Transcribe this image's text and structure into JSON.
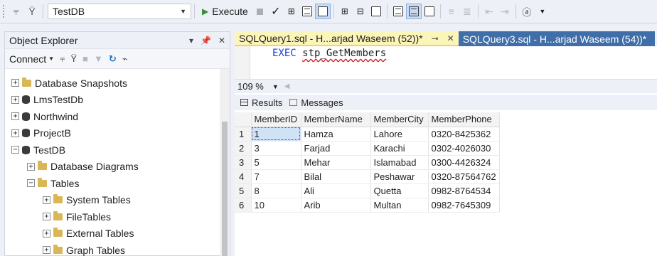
{
  "toolbar": {
    "database_selector": "TestDB",
    "execute_label": "Execute"
  },
  "object_explorer": {
    "title": "Object Explorer",
    "header_controls": [
      "▾",
      "ᵽ",
      "✕"
    ],
    "connect_label": "Connect",
    "tree": [
      {
        "label": "Database Snapshots",
        "icon": "folder",
        "expander": "+",
        "indent": 1
      },
      {
        "label": "LmsTestDb",
        "icon": "database",
        "expander": "+",
        "indent": 1
      },
      {
        "label": "Northwind",
        "icon": "database",
        "expander": "+",
        "indent": 1
      },
      {
        "label": "ProjectB",
        "icon": "database",
        "expander": "+",
        "indent": 1
      },
      {
        "label": "TestDB",
        "icon": "database",
        "expander": "−",
        "indent": 1
      },
      {
        "label": "Database Diagrams",
        "icon": "folder",
        "expander": "+",
        "indent": 2
      },
      {
        "label": "Tables",
        "icon": "folder",
        "expander": "−",
        "indent": 2
      },
      {
        "label": "System Tables",
        "icon": "folder",
        "expander": "+",
        "indent": 3
      },
      {
        "label": "FileTables",
        "icon": "folder",
        "expander": "+",
        "indent": 3
      },
      {
        "label": "External Tables",
        "icon": "folder",
        "expander": "+",
        "indent": 3
      },
      {
        "label": "Graph Tables",
        "icon": "folder",
        "expander": "+",
        "indent": 3
      }
    ]
  },
  "editor": {
    "tabs": [
      {
        "label": "SQLQuery1.sql - H...arjad Waseem (52))*",
        "active": true
      },
      {
        "label": "SQLQuery3.sql - H...arjad Waseem (54))*",
        "active": false
      }
    ],
    "code": {
      "keyword": "EXEC",
      "procedure": "stp_GetMembers"
    },
    "zoom": "109 %"
  },
  "results": {
    "tabs": [
      "Results",
      "Messages"
    ],
    "columns": [
      "MemberID",
      "MemberName",
      "MemberCity",
      "MemberPhone"
    ],
    "rows": [
      [
        "1",
        "1",
        "Hamza",
        "Lahore",
        "0320-8425362"
      ],
      [
        "2",
        "3",
        "Farjad",
        "Karachi",
        "0302-4026030"
      ],
      [
        "3",
        "5",
        "Mehar",
        "Islamabad",
        "0300-4426324"
      ],
      [
        "4",
        "7",
        "Bilal",
        "Peshawar",
        "0320-87564762"
      ],
      [
        "5",
        "8",
        "Ali",
        "Quetta",
        "0982-8764534"
      ],
      [
        "6",
        "10",
        "Arib",
        "Multan",
        "0982-7645309"
      ]
    ]
  }
}
